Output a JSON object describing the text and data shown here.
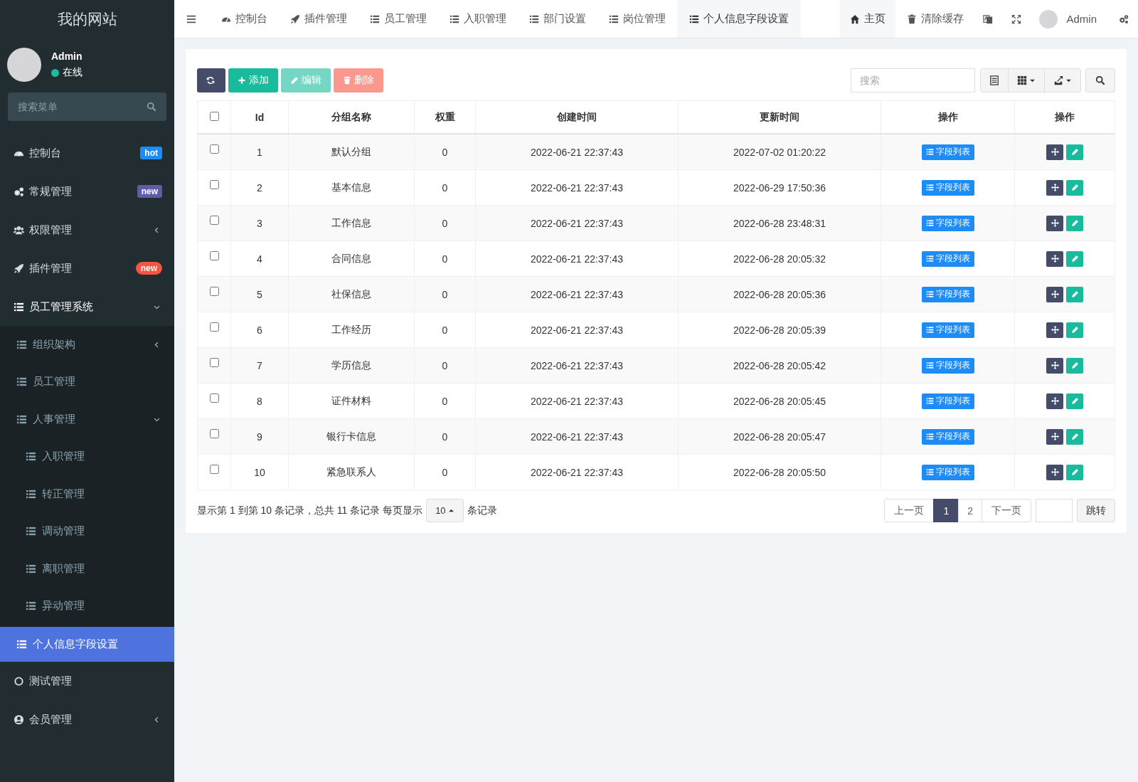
{
  "sidebar": {
    "site_title": "我的网站",
    "user": {
      "name": "Admin",
      "status": "在线",
      "online": true
    },
    "search": {
      "placeholder": "搜索菜单"
    },
    "items": [
      {
        "label": "控制台",
        "selected": false,
        "badge": {
          "text": "hot",
          "color": "#1e8cf7"
        }
      },
      {
        "label": "常规管理",
        "selected": false,
        "badge": {
          "text": "new",
          "color": "#605ca8"
        }
      },
      {
        "label": "权限管理",
        "selected": false,
        "expanded": false
      },
      {
        "label": "插件管理",
        "selected": false,
        "badge": {
          "text": "new",
          "color": "#f75444"
        }
      },
      {
        "label": "员工管理系统",
        "selected": false,
        "expanded": true,
        "children": [
          {
            "label": "组织架构",
            "selected": false,
            "expanded": false
          },
          {
            "label": "员工管理",
            "selected": false
          },
          {
            "label": "人事管理",
            "selected": false,
            "expanded": true,
            "children": [
              {
                "label": "入职管理",
                "selected": false
              },
              {
                "label": "转正管理",
                "selected": false
              },
              {
                "label": "调动管理",
                "selected": false
              },
              {
                "label": "离职管理",
                "selected": false
              },
              {
                "label": "异动管理",
                "selected": false
              }
            ]
          },
          {
            "label": "个人信息字段设置",
            "selected": true
          }
        ]
      },
      {
        "label": "测试管理",
        "selected": false
      },
      {
        "label": "会员管理",
        "selected": false,
        "expanded": false
      }
    ]
  },
  "topnav": {
    "tabs": [
      {
        "label": "控制台",
        "selected": false
      },
      {
        "label": "插件管理",
        "selected": false
      },
      {
        "label": "员工管理",
        "selected": false
      },
      {
        "label": "入职管理",
        "selected": false
      },
      {
        "label": "部门设置",
        "selected": false
      },
      {
        "label": "岗位管理",
        "selected": false
      },
      {
        "label": "个人信息字段设置",
        "selected": true
      }
    ],
    "links": [
      {
        "label": "主页",
        "selected": true
      },
      {
        "label": "清除缓存",
        "selected": false
      }
    ],
    "user": "Admin"
  },
  "toolbar": {
    "buttons": [
      {
        "kind": "refresh",
        "disabled": false
      },
      {
        "kind": "add",
        "label": "添加",
        "disabled": false
      },
      {
        "kind": "edit",
        "label": "编辑",
        "disabled": true
      },
      {
        "kind": "delete",
        "label": "删除",
        "disabled": true
      }
    ],
    "search": {
      "placeholder": "搜索"
    }
  },
  "table": {
    "header_checked": false,
    "columns": [
      "Id",
      "分组名称",
      "权重",
      "创建时间",
      "更新时间",
      "操作",
      "操作"
    ],
    "rows": [
      {
        "checked": false,
        "cells": [
          "1",
          "默认分组",
          "0",
          "2022-06-21 22:37:43",
          "2022-07-02 01:20:22"
        ],
        "action": "字段列表"
      },
      {
        "checked": false,
        "cells": [
          "2",
          "基本信息",
          "0",
          "2022-06-21 22:37:43",
          "2022-06-29 17:50:36"
        ],
        "action": "字段列表"
      },
      {
        "checked": false,
        "cells": [
          "3",
          "工作信息",
          "0",
          "2022-06-21 22:37:43",
          "2022-06-28 23:48:31"
        ],
        "action": "字段列表"
      },
      {
        "checked": false,
        "cells": [
          "4",
          "合同信息",
          "0",
          "2022-06-21 22:37:43",
          "2022-06-28 20:05:32"
        ],
        "action": "字段列表"
      },
      {
        "checked": false,
        "cells": [
          "5",
          "社保信息",
          "0",
          "2022-06-21 22:37:43",
          "2022-06-28 20:05:36"
        ],
        "action": "字段列表"
      },
      {
        "checked": false,
        "cells": [
          "6",
          "工作经历",
          "0",
          "2022-06-21 22:37:43",
          "2022-06-28 20:05:39"
        ],
        "action": "字段列表"
      },
      {
        "checked": false,
        "cells": [
          "7",
          "学历信息",
          "0",
          "2022-06-21 22:37:43",
          "2022-06-28 20:05:42"
        ],
        "action": "字段列表"
      },
      {
        "checked": false,
        "cells": [
          "8",
          "证件材料",
          "0",
          "2022-06-21 22:37:43",
          "2022-06-28 20:05:45"
        ],
        "action": "字段列表"
      },
      {
        "checked": false,
        "cells": [
          "9",
          "银行卡信息",
          "0",
          "2022-06-21 22:37:43",
          "2022-06-28 20:05:47"
        ],
        "action": "字段列表"
      },
      {
        "checked": false,
        "cells": [
          "10",
          "紧急联系人",
          "0",
          "2022-06-21 22:37:43",
          "2022-06-28 20:05:50"
        ],
        "action": "字段列表"
      }
    ]
  },
  "pagination": {
    "summary": "显示第 1 到第 10 条记录，总共 11 条记录 每页显示",
    "page_size": "10",
    "suffix": "条记录",
    "pages": [
      {
        "label": "上一页",
        "selected": false
      },
      {
        "label": "1",
        "selected": true
      },
      {
        "label": "2",
        "selected": false
      },
      {
        "label": "下一页",
        "selected": false
      }
    ],
    "jump": "跳转"
  }
}
